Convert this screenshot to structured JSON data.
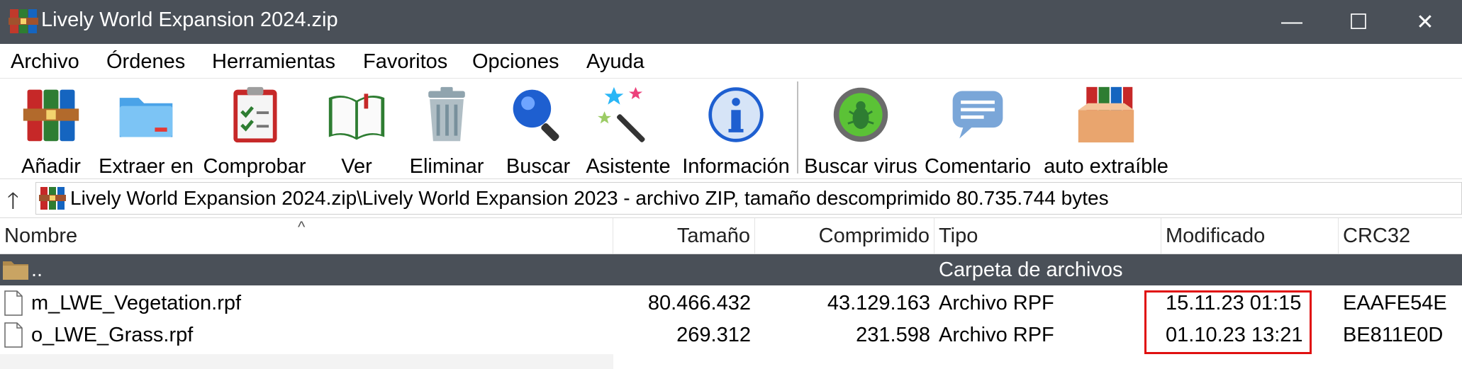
{
  "window": {
    "title": "Lively World Expansion 2024.zip",
    "minimize_glyph": "—",
    "maximize_glyph": "☐",
    "close_glyph": "✕",
    "app_icon": "winrar-books-icon"
  },
  "menu": [
    "Archivo",
    "Órdenes",
    "Herramientas",
    "Favoritos",
    "Opciones",
    "Ayuda"
  ],
  "toolbar": [
    {
      "label": "Añadir",
      "icon": "add-books-icon"
    },
    {
      "label": "Extraer en",
      "icon": "extract-folder-icon"
    },
    {
      "label": "Comprobar",
      "icon": "clipboard-check-icon"
    },
    {
      "label": "Ver",
      "icon": "open-book-icon"
    },
    {
      "label": "Eliminar",
      "icon": "trash-can-icon"
    },
    {
      "label": "Buscar",
      "icon": "magnifier-icon"
    },
    {
      "label": "Asistente",
      "icon": "magic-wand-icon"
    },
    {
      "label": "Información",
      "icon": "info-icon"
    },
    {
      "label": "Buscar virus",
      "icon": "virus-scan-icon"
    },
    {
      "label": "Comentario",
      "icon": "comment-bubble-icon"
    },
    {
      "label": "auto extraíble",
      "icon": "sfx-box-icon"
    }
  ],
  "address": {
    "up_glyph": "🡑",
    "path": "Lively World Expansion 2024.zip\\Lively World Expansion 2023 - archivo ZIP, tamaño descomprimido 80.735.744 bytes"
  },
  "columns": {
    "name": "Nombre",
    "size": "Tamaño",
    "packed": "Comprimido",
    "type": "Tipo",
    "modified": "Modificado",
    "crc": "CRC32",
    "sort_glyph": "^"
  },
  "rows": [
    {
      "name": "..",
      "size": "",
      "packed": "",
      "type": "Carpeta de archivos",
      "modified": "",
      "crc": ""
    },
    {
      "name": "m_LWE_Vegetation.rpf",
      "size": "80.466.432",
      "packed": "43.129.163",
      "type": "Archivo RPF",
      "modified": "15.11.23 01:15",
      "crc": "EAAFE54E"
    },
    {
      "name": "o_LWE_Grass.rpf",
      "size": "269.312",
      "packed": "231.598",
      "type": "Archivo RPF",
      "modified": "01.10.23 13:21",
      "crc": "BE811E0D"
    }
  ],
  "colors": {
    "titlebar": "#4a5058",
    "selected_row": "#4a5058",
    "highlight_border": "#e01010"
  }
}
